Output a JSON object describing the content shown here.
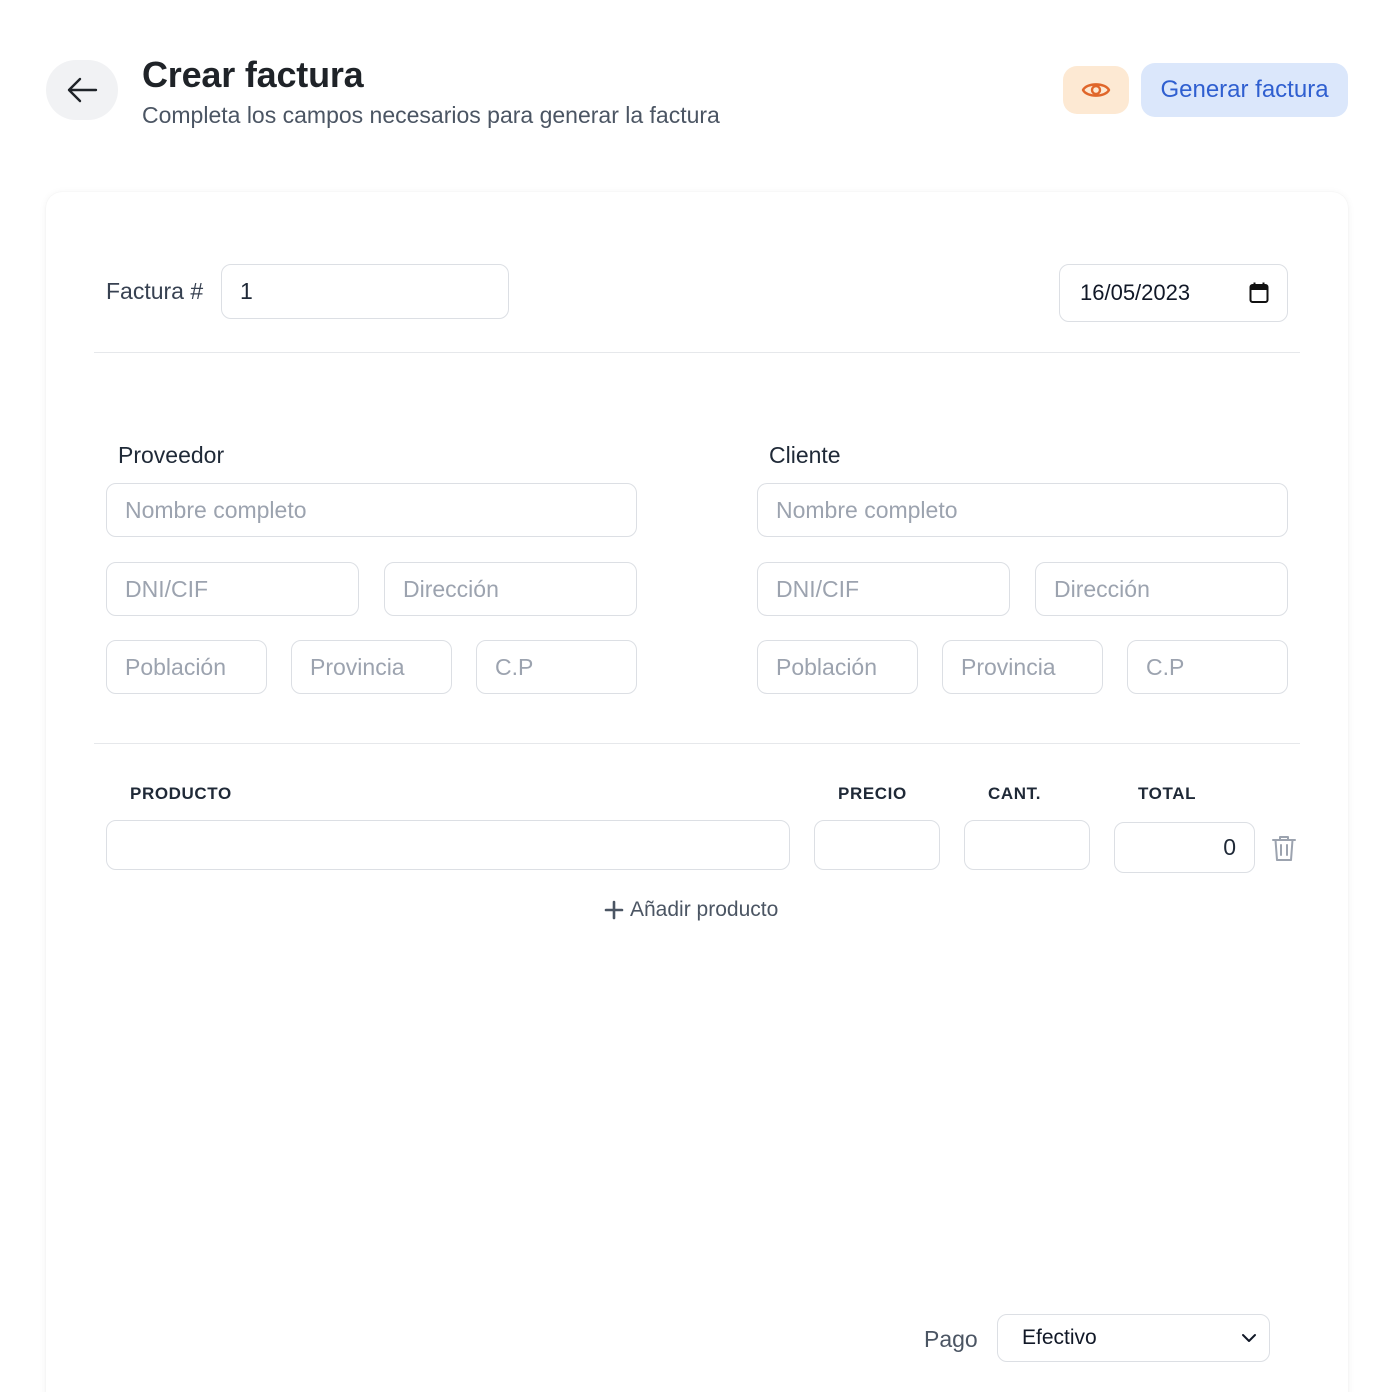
{
  "header": {
    "title": "Crear factura",
    "subtitle": "Completa los campos necesarios para generar la factura",
    "back_icon": "arrow-left-icon",
    "preview_icon": "eye-icon",
    "generate_label": "Generar factura"
  },
  "invoice": {
    "number_label": "Factura #",
    "number_value": "1",
    "date_value": "16/05/2023",
    "date_icon": "calendar-icon"
  },
  "supplier": {
    "title": "Proveedor",
    "name_placeholder": "Nombre completo",
    "dni_placeholder": "DNI/CIF",
    "address_placeholder": "Dirección",
    "town_placeholder": "Población",
    "province_placeholder": "Provincia",
    "zip_placeholder": "C.P"
  },
  "client": {
    "title": "Cliente",
    "name_placeholder": "Nombre completo",
    "dni_placeholder": "DNI/CIF",
    "address_placeholder": "Dirección",
    "town_placeholder": "Población",
    "province_placeholder": "Provincia",
    "zip_placeholder": "C.P"
  },
  "products": {
    "columns": [
      "PRODUCTO",
      "PRECIO",
      "CANT.",
      "TOTAL"
    ],
    "rows": [
      {
        "product": "",
        "price": "",
        "quantity": "",
        "total": "0"
      }
    ],
    "delete_icon": "trash-icon",
    "add_label": "Añadir producto",
    "add_icon": "plus-icon"
  },
  "payment": {
    "label": "Pago",
    "selected": "Efectivo",
    "dropdown_icon": "chevron-down-icon"
  },
  "colors": {
    "accent_blue": "#2f5fd0",
    "accent_blue_bg": "#dbe7fb",
    "accent_orange": "#e0662a",
    "accent_orange_bg": "#fde9d3"
  }
}
